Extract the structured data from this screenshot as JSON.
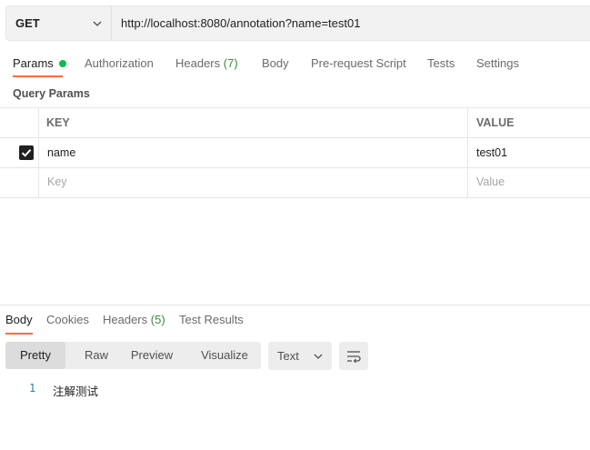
{
  "request": {
    "method": "GET",
    "url": "http://localhost:8080/annotation?name=test01"
  },
  "request_tabs": [
    {
      "label": "Params",
      "active": true,
      "indicator": "green-dot"
    },
    {
      "label": "Authorization"
    },
    {
      "label": "Headers",
      "count": "(7)"
    },
    {
      "label": "Body"
    },
    {
      "label": "Pre-request Script"
    },
    {
      "label": "Tests"
    },
    {
      "label": "Settings"
    }
  ],
  "query_params": {
    "title": "Query Params",
    "headers": {
      "key": "KEY",
      "value": "VALUE"
    },
    "rows": [
      {
        "checked": true,
        "key": "name",
        "value": "test01"
      }
    ],
    "placeholder": {
      "key": "Key",
      "value": "Value"
    }
  },
  "response": {
    "tabs": [
      {
        "label": "Body",
        "active": true
      },
      {
        "label": "Cookies"
      },
      {
        "label": "Headers",
        "count": "(5)"
      },
      {
        "label": "Test Results"
      }
    ],
    "view_modes": [
      "Pretty",
      "Raw",
      "Preview",
      "Visualize"
    ],
    "active_view": "Pretty",
    "format": "Text",
    "body_lines": [
      {
        "line": "1",
        "text": "注解测试"
      }
    ]
  },
  "colors": {
    "accent": "#ff6c37",
    "status_green": "#0cbb52",
    "count_green": "#3c8a3f",
    "line_number": "#2a7fb8"
  }
}
